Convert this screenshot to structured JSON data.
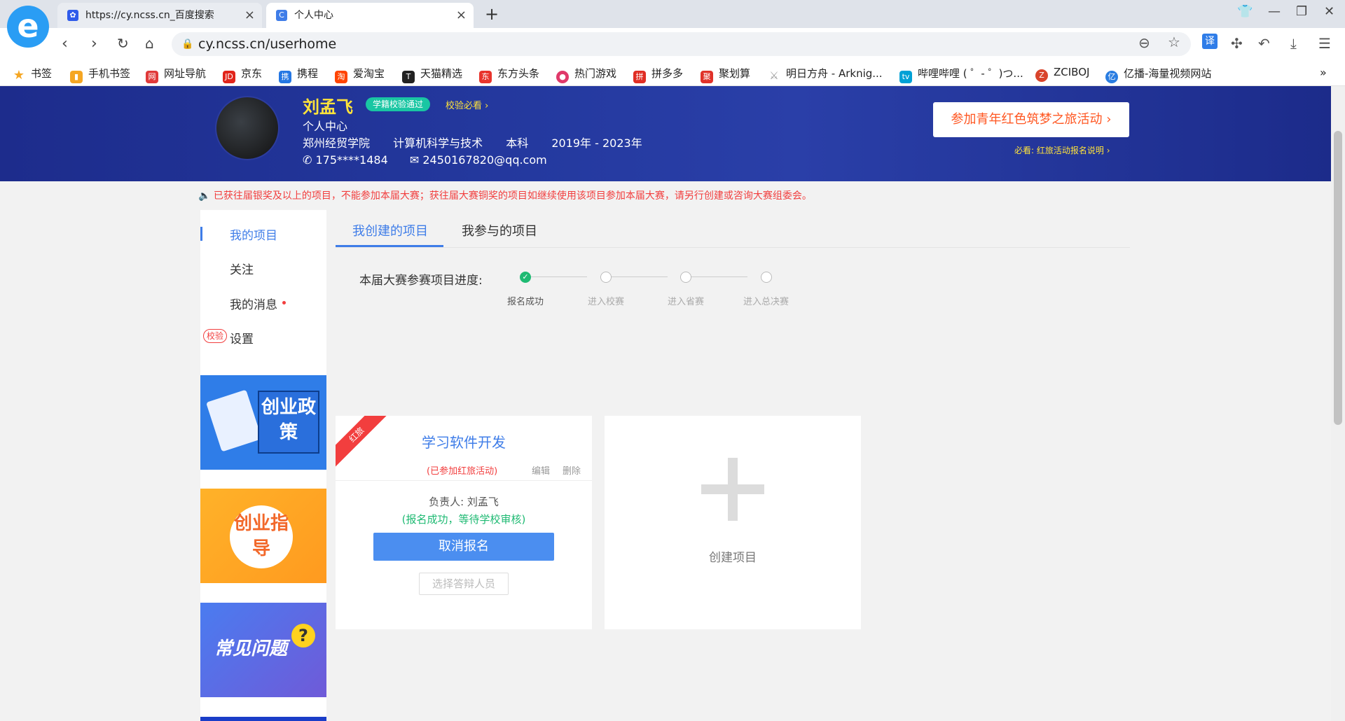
{
  "browser": {
    "tabs": [
      {
        "title": "https://cy.ncss.cn_百度搜索",
        "active": false
      },
      {
        "title": "个人中心",
        "active": true
      }
    ],
    "url": "cy.ncss.cn/userhome",
    "translate_label": "译"
  },
  "bookmarks": [
    {
      "label": "书签",
      "color": "#f5a623"
    },
    {
      "label": "手机书签",
      "color": "#f5a623"
    },
    {
      "label": "网址导航",
      "color": "#e03a3a"
    },
    {
      "label": "京东",
      "color": "#e1251b"
    },
    {
      "label": "携程",
      "color": "#2577e3"
    },
    {
      "label": "爱淘宝",
      "color": "#ff4400"
    },
    {
      "label": "天猫精选",
      "color": "#222222"
    },
    {
      "label": "东方头条",
      "color": "#e8342c"
    },
    {
      "label": "热门游戏",
      "color": "#e0396a"
    },
    {
      "label": "拼多多",
      "color": "#e02e24"
    },
    {
      "label": "聚划算",
      "color": "#e0322a"
    },
    {
      "label": "明日方舟 - Arknig...",
      "color": "#999999"
    },
    {
      "label": "哔哩哔哩 ( ゜- ゜)つ...",
      "color": "#00a1d6"
    },
    {
      "label": "ZCIBOJ",
      "color": "#d9442b"
    },
    {
      "label": "亿播-海量视频网站",
      "color": "#2a7de1"
    }
  ],
  "profile": {
    "name": "刘孟飞",
    "verify_badge": "学籍校验通过",
    "verify_link": "校验必看",
    "center_title": "个人中心",
    "school": "郑州经贸学院",
    "major": "计算机科学与技术",
    "degree": "本科",
    "years": "2019年 - 2023年",
    "phone": "175****1484",
    "email": "2450167820@qq.com"
  },
  "join_button": "参加青年红色筑梦之旅活动",
  "must_read": "必看: 红旅活动报名说明",
  "notice": "已获往届银奖及以上的项目，不能参加本届大赛；获往届大赛铜奖的项目如继续使用该项目参加本届大赛，请另行创建或咨询大赛组委会。",
  "sidebar": {
    "items": [
      "我的项目",
      "关注",
      "我的消息",
      "设置"
    ],
    "school_tag": "校验",
    "banners": [
      "创业政策",
      "创业指导",
      "常见问题"
    ]
  },
  "tabs": [
    "我创建的项目",
    "我参与的项目"
  ],
  "progress": {
    "label": "本届大赛参赛项目进度:",
    "steps": [
      "报名成功",
      "进入校赛",
      "进入省赛",
      "进入总决赛"
    ],
    "completed": 1
  },
  "project": {
    "ribbon": "红旅",
    "title": "学习软件开发",
    "subtitle": "(已参加红旅活动)",
    "edit": "编辑",
    "delete": "删除",
    "owner": "负责人: 刘孟飞",
    "status": "(报名成功，等待学校审核)",
    "cancel_button": "取消报名",
    "choose_button": "选择答辩人员"
  },
  "create_project": "创建项目"
}
